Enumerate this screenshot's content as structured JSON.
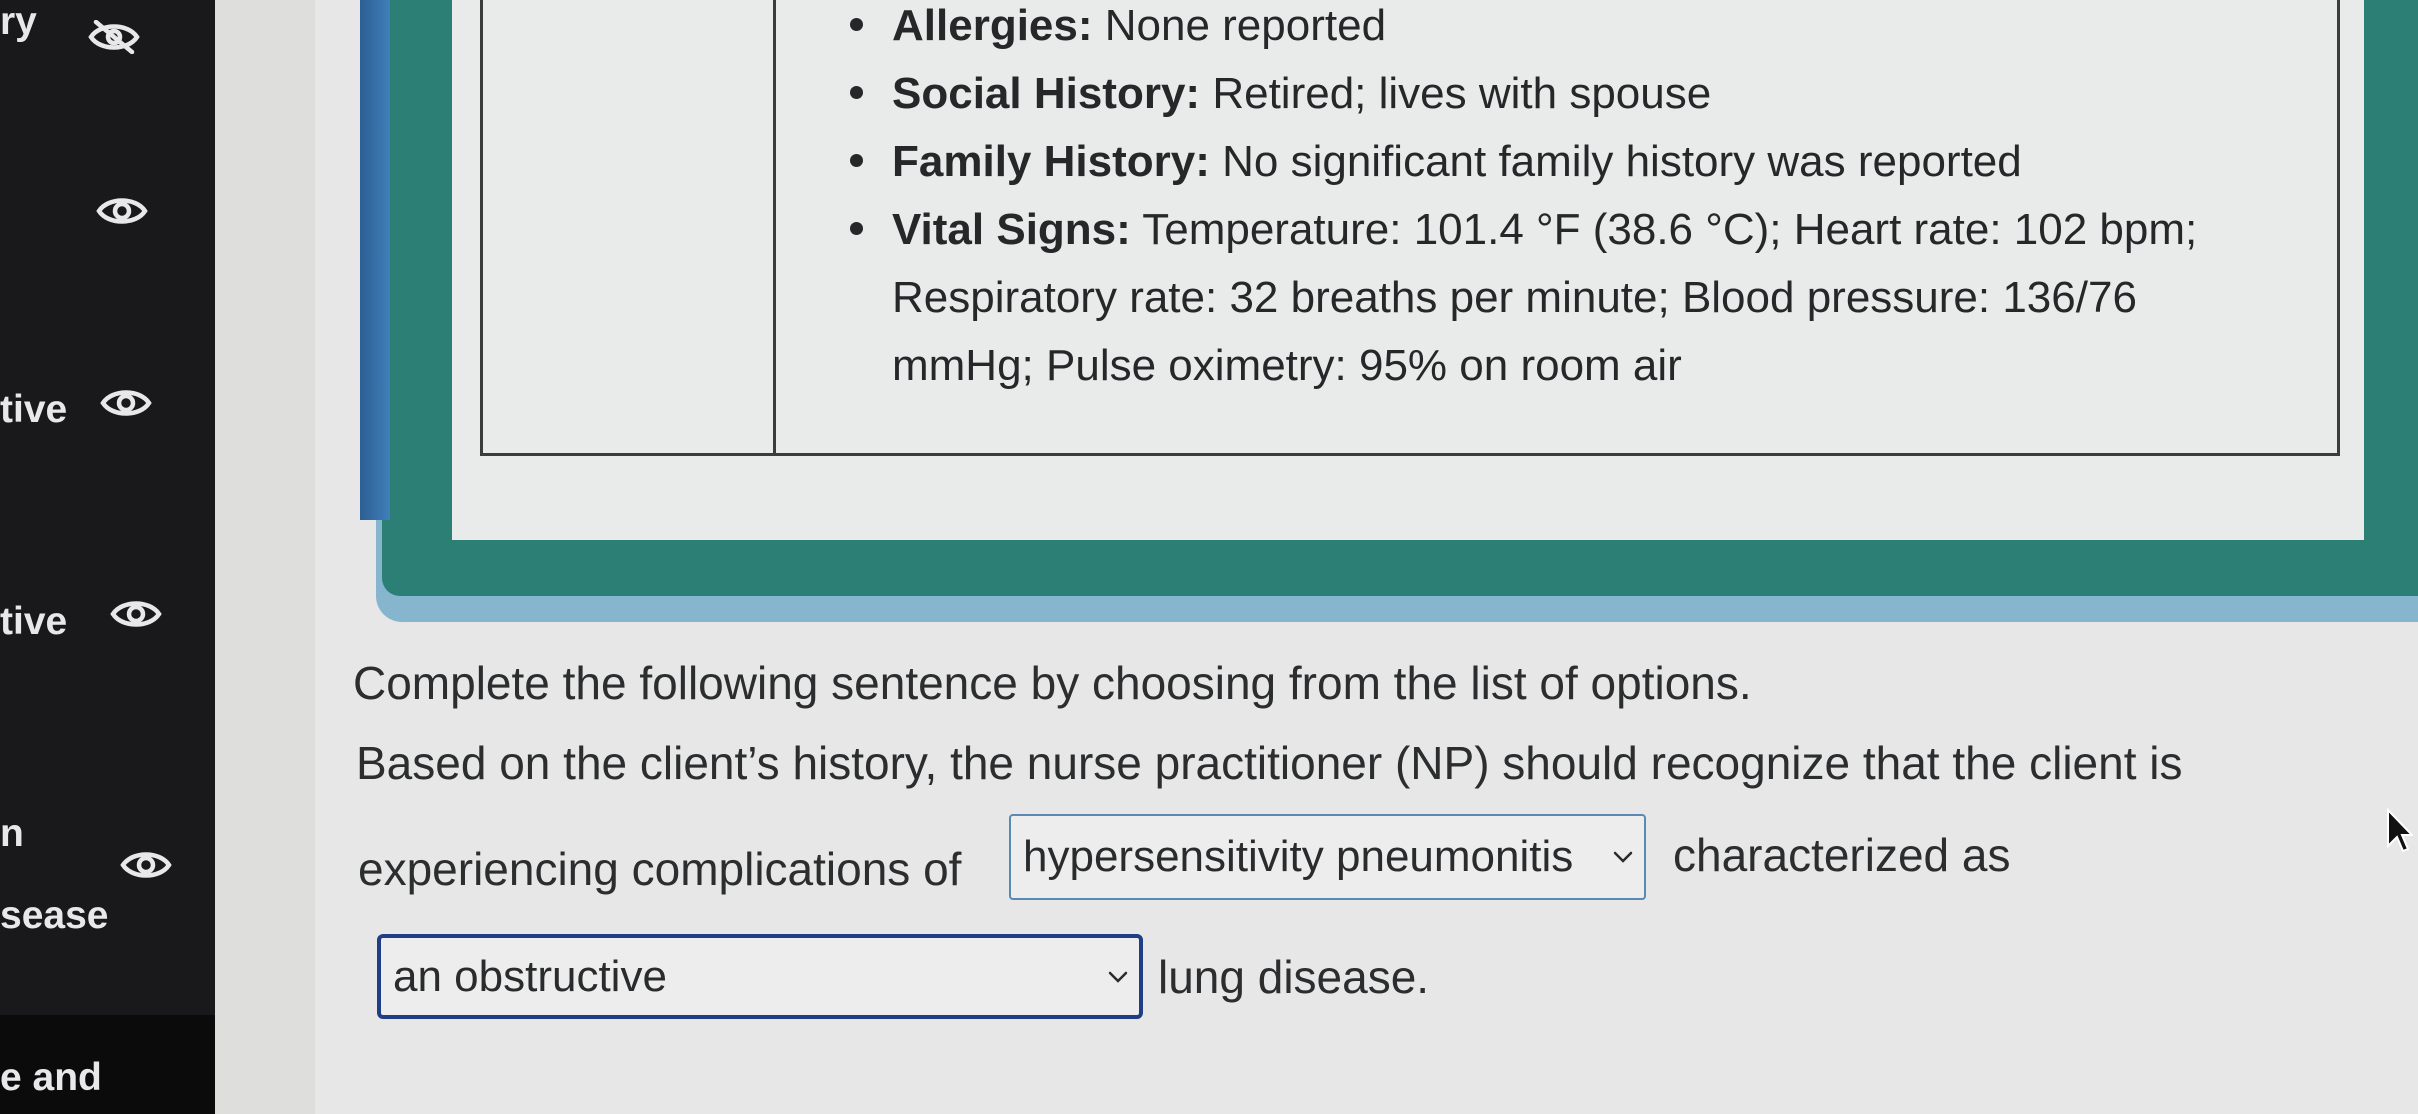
{
  "sidebar": {
    "items": [
      {
        "label": "ry",
        "icon": "eye-slash-icon",
        "visible": false
      },
      {
        "label": "",
        "icon": "eye-icon",
        "visible": true
      },
      {
        "label": "tive",
        "icon": "eye-icon",
        "visible": true
      },
      {
        "label": "tive",
        "icon": "eye-icon",
        "visible": true
      },
      {
        "label": "n",
        "icon": "eye-icon",
        "visible": true
      },
      {
        "label": "sease",
        "icon": "",
        "visible": true
      },
      {
        "label": "e and",
        "icon": "",
        "visible": true
      }
    ]
  },
  "case": {
    "findings": [
      {
        "term": "Allergies:",
        "text": " None reported"
      },
      {
        "term": "Social History:",
        "text": " Retired; lives with spouse"
      },
      {
        "term": "Family History:",
        "text": " No significant family history was reported"
      },
      {
        "term": "Vital Signs:",
        "text": " Temperature: 101.4 °F (38.6 °C); Heart rate: 102 bpm; Respiratory rate: 32 breaths per minute; Blood pressure: 136/76 mmHg; Pulse oximetry: 95% on room air"
      }
    ]
  },
  "question": {
    "instruction": "Complete the following sentence by choosing from the list of options.",
    "line1": "Based on the client’s history, the nurse practitioner (NP) should recognize that the client is",
    "line2_prefix": "experiencing complications of",
    "dropdown1_value": "hypersensitivity pneumonitis",
    "line2_suffix": "characterized as",
    "dropdown2_value": "an obstructive",
    "line3_suffix": "lung disease."
  },
  "colors": {
    "sidebar_bg": "#19191b",
    "frame_teal": "#2b7f74",
    "frame_blue": "#86b6ce",
    "dropdown_focus_border": "#1f3e85"
  }
}
